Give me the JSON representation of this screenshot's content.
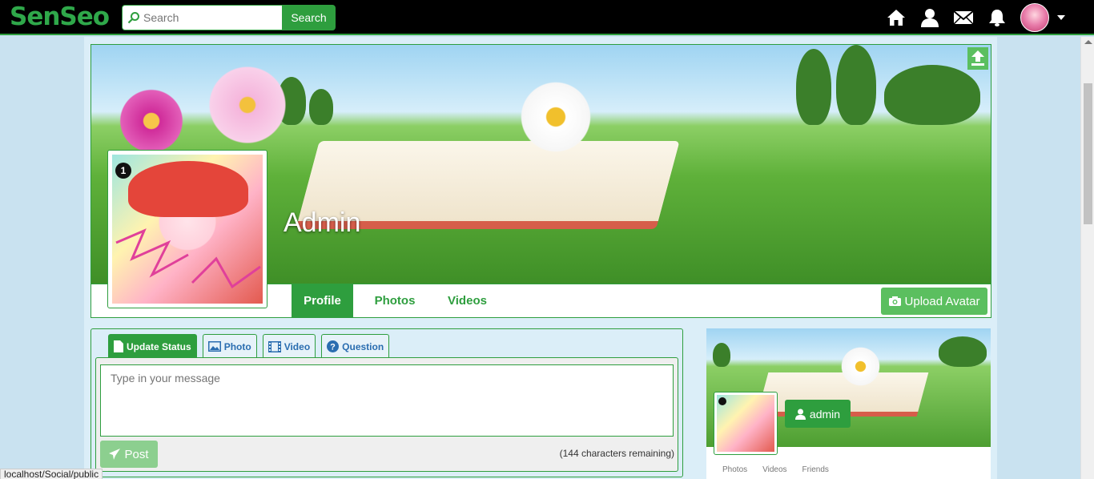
{
  "navbar": {
    "brand": "SenSeo",
    "search_placeholder": "Search",
    "search_button": "Search",
    "icons": [
      "home-icon",
      "user-icon",
      "mail-icon",
      "bell-icon"
    ]
  },
  "profile": {
    "name": "Admin",
    "tabs": [
      {
        "label": "Profile",
        "active": true
      },
      {
        "label": "Photos",
        "active": false
      },
      {
        "label": "Videos",
        "active": false
      }
    ],
    "upload_avatar_label": "Upload Avatar",
    "avatar_badge": "1"
  },
  "composer": {
    "tabs": [
      {
        "label": "Update Status",
        "icon": "document-icon",
        "active": true
      },
      {
        "label": "Photo",
        "icon": "image-icon",
        "active": false
      },
      {
        "label": "Video",
        "icon": "film-icon",
        "active": false
      },
      {
        "label": "Question",
        "icon": "question-icon",
        "active": false
      }
    ],
    "message_placeholder": "Type in your message",
    "post_label": "Post",
    "char_count": "(144 characters remaining)"
  },
  "mini_card": {
    "username": "admin",
    "tabs": [
      "Photos",
      "Videos",
      "Friends"
    ]
  },
  "status_bar": {
    "url": "localhost/Social/public"
  },
  "colors": {
    "brand_green": "#2e9e3e",
    "light_green": "#5bbf5f",
    "page_bg": "#c9e2f0",
    "navbar_bg": "#000000"
  }
}
